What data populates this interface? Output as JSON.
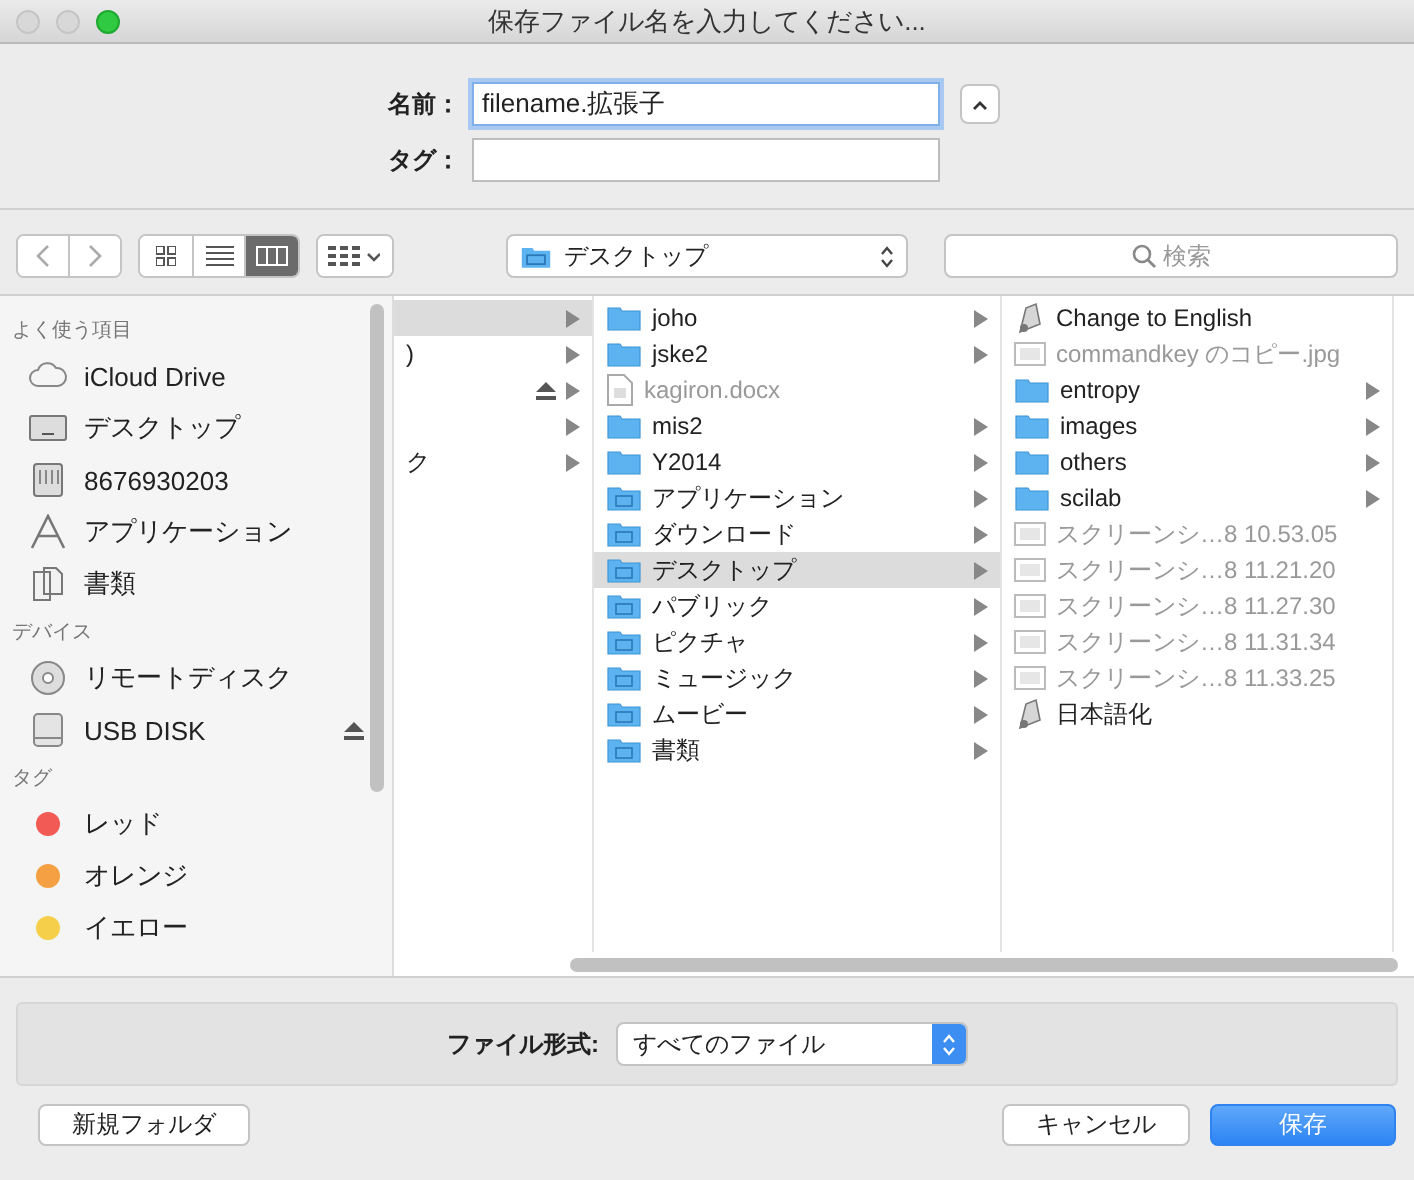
{
  "window": {
    "title": "保存ファイル名を入力してください..."
  },
  "form": {
    "name_label": "名前：",
    "name_value": "filename.拡張子",
    "expanded": true,
    "tag_label": "タグ："
  },
  "toolbar": {
    "views": [
      {
        "kind": "icons",
        "selected": false
      },
      {
        "kind": "list",
        "selected": false
      },
      {
        "kind": "columns",
        "selected": true
      }
    ],
    "location": "デスクトップ",
    "search_placeholder": "検索"
  },
  "sidebar": {
    "sections": [
      {
        "title": "よく使う項目",
        "items": [
          {
            "kind": "cloud",
            "label": "iCloud Drive"
          },
          {
            "kind": "desktop",
            "label": "デスクトップ"
          },
          {
            "kind": "drive",
            "label": "8676930203"
          },
          {
            "kind": "apps",
            "label": "アプリケーション"
          },
          {
            "kind": "docs",
            "label": "書類"
          }
        ]
      },
      {
        "title": "デバイス",
        "items": [
          {
            "kind": "disc",
            "label": "リモートディスク"
          },
          {
            "kind": "usb",
            "label": "USB DISK",
            "eject": true
          }
        ]
      },
      {
        "title": "タグ",
        "items": [
          {
            "kind": "tag",
            "label": "レッド",
            "color": "#f25a55"
          },
          {
            "kind": "tag",
            "label": "オレンジ",
            "color": "#f5a043"
          },
          {
            "kind": "tag",
            "label": "イエロー",
            "color": "#f6cf4a"
          }
        ]
      }
    ]
  },
  "columns": [
    {
      "items": [
        {
          "selected": true,
          "folder": true
        },
        {
          "label": ")",
          "selected": false,
          "folder": true
        },
        {
          "selected": false,
          "folder": true,
          "eject": true
        },
        {
          "selected": false,
          "folder": true
        },
        {
          "label": "ク",
          "selected": false,
          "folder": true
        }
      ]
    },
    {
      "items": [
        {
          "kind": "folder",
          "label": "joho",
          "selected": false,
          "folder": true,
          "dim": false
        },
        {
          "kind": "folder",
          "label": "jske2",
          "selected": false,
          "folder": true,
          "dim": false
        },
        {
          "kind": "doc",
          "label": "kagiron.docx",
          "selected": false,
          "folder": false,
          "dim": true
        },
        {
          "kind": "folder",
          "label": "mis2",
          "selected": false,
          "folder": true,
          "dim": false
        },
        {
          "kind": "folder",
          "label": "Y2014",
          "selected": false,
          "folder": true,
          "dim": false
        },
        {
          "kind": "special",
          "label": "アプリケーション",
          "selected": false,
          "folder": true,
          "dim": false
        },
        {
          "kind": "special",
          "label": "ダウンロード",
          "selected": false,
          "folder": true,
          "dim": false
        },
        {
          "kind": "special",
          "label": "デスクトップ",
          "selected": true,
          "folder": true,
          "dim": false
        },
        {
          "kind": "special",
          "label": "パブリック",
          "selected": false,
          "folder": true,
          "dim": false
        },
        {
          "kind": "special",
          "label": "ピクチャ",
          "selected": false,
          "folder": true,
          "dim": false
        },
        {
          "kind": "special",
          "label": "ミュージック",
          "selected": false,
          "folder": true,
          "dim": false
        },
        {
          "kind": "special",
          "label": "ムービー",
          "selected": false,
          "folder": true,
          "dim": false
        },
        {
          "kind": "special",
          "label": "書類",
          "selected": false,
          "folder": true,
          "dim": false
        }
      ]
    },
    {
      "items": [
        {
          "kind": "script",
          "label": "Change to English",
          "selected": false,
          "folder": false,
          "dim": false
        },
        {
          "kind": "image",
          "label": "commandkey のコピー.jpg",
          "selected": false,
          "folder": false,
          "dim": true
        },
        {
          "kind": "folder",
          "label": "entropy",
          "selected": false,
          "folder": true,
          "dim": false
        },
        {
          "kind": "folder",
          "label": "images",
          "selected": false,
          "folder": true,
          "dim": false
        },
        {
          "kind": "folder",
          "label": "others",
          "selected": false,
          "folder": true,
          "dim": false
        },
        {
          "kind": "folder",
          "label": "scilab",
          "selected": false,
          "folder": true,
          "dim": false
        },
        {
          "kind": "image",
          "label": "スクリーンシ…8 10.53.05",
          "selected": false,
          "folder": false,
          "dim": true
        },
        {
          "kind": "image",
          "label": "スクリーンシ…8 11.21.20",
          "selected": false,
          "folder": false,
          "dim": true
        },
        {
          "kind": "image",
          "label": "スクリーンシ…8 11.27.30",
          "selected": false,
          "folder": false,
          "dim": true
        },
        {
          "kind": "image",
          "label": "スクリーンシ…8 11.31.34",
          "selected": false,
          "folder": false,
          "dim": true
        },
        {
          "kind": "image",
          "label": "スクリーンシ…8 11.33.25",
          "selected": false,
          "folder": false,
          "dim": true
        },
        {
          "kind": "script",
          "label": "日本語化",
          "selected": false,
          "folder": false,
          "dim": false
        }
      ]
    }
  ],
  "format": {
    "label": "ファイル形式:",
    "value": "すべてのファイル"
  },
  "buttons": {
    "new_folder": "新規フォルダ",
    "cancel": "キャンセル",
    "save": "保存"
  }
}
